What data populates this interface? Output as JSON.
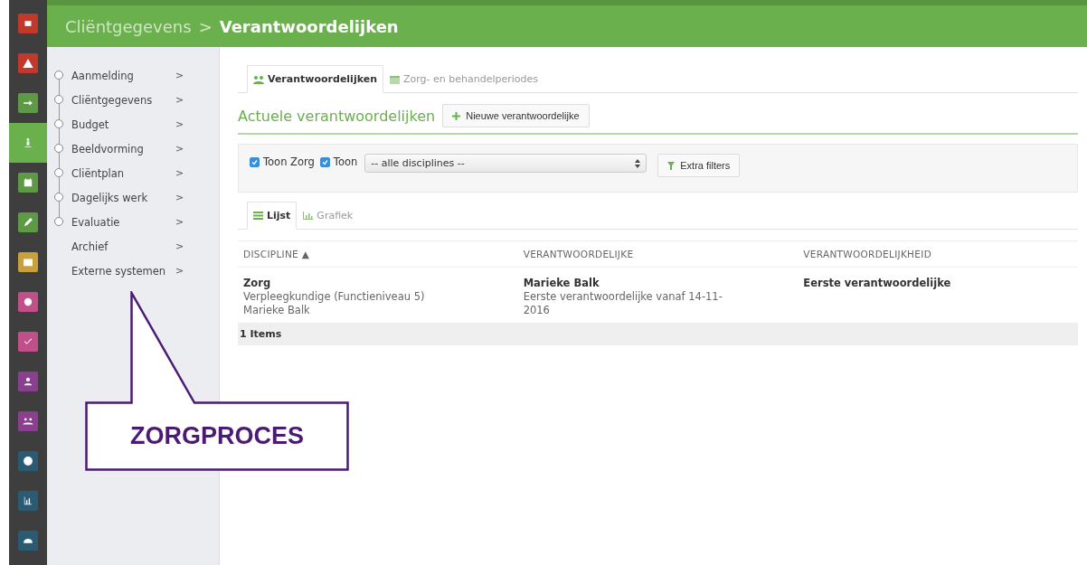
{
  "rail": [
    {
      "color": "#c0392b",
      "selected": false
    },
    {
      "color": "#c0392b",
      "selected": false
    },
    {
      "color": "#5e9a45",
      "selected": false
    },
    {
      "color": "#6ab04c",
      "selected": true
    },
    {
      "color": "#5e9a45",
      "selected": false
    },
    {
      "color": "#5e9a45",
      "selected": false
    },
    {
      "color": "#c9a13a",
      "selected": false
    },
    {
      "color": "#c0508a",
      "selected": false
    },
    {
      "color": "#c0508a",
      "selected": false
    },
    {
      "color": "#8a3f8f",
      "selected": false
    },
    {
      "color": "#8a3f8f",
      "selected": false
    },
    {
      "color": "#2b5a73",
      "selected": false
    },
    {
      "color": "#2b5a73",
      "selected": false
    },
    {
      "color": "#2b5a73",
      "selected": false
    }
  ],
  "header": {
    "parent": "Cliëntgegevens",
    "separator": ">",
    "title": "Verantwoordelijken"
  },
  "sidebar": {
    "items": [
      {
        "label": "Aanmelding",
        "kind": "step",
        "chevron": ">"
      },
      {
        "label": "Cliëntgegevens",
        "kind": "step",
        "chevron": ">"
      },
      {
        "label": "Budget",
        "kind": "step",
        "chevron": ">"
      },
      {
        "label": "Beeldvorming",
        "kind": "step",
        "chevron": ">"
      },
      {
        "label": "Cliëntplan",
        "kind": "step",
        "chevron": ">"
      },
      {
        "label": "Dagelijks werk",
        "kind": "step",
        "chevron": ">"
      },
      {
        "label": "Evaluatie",
        "kind": "step",
        "chevron": ">"
      },
      {
        "label": "Archief",
        "kind": "link",
        "chevron": ">"
      },
      {
        "label": "Externe systemen",
        "kind": "link",
        "chevron": ">"
      }
    ]
  },
  "tabs": [
    {
      "label": "Verantwoordelijken",
      "selected": true
    },
    {
      "label": "Zorg- en behandelperiodes",
      "selected": false
    }
  ],
  "section": {
    "title": "Actuele verantwoordelijken",
    "button": "Nieuwe verantwoordelijke"
  },
  "filters": {
    "checks": [
      {
        "label": "Toon Zorg",
        "checked": true
      },
      {
        "label": "Toon",
        "checked": true
      }
    ],
    "select": "-- alle disciplines --",
    "button": "Extra filters"
  },
  "view_tabs": [
    {
      "label": "Lijst",
      "selected": true
    },
    {
      "label": "Grafiek",
      "selected": false
    }
  ],
  "table": {
    "columns": [
      {
        "label": "DISCIPLINE",
        "sort": "▲"
      },
      {
        "label": "VERANTWOORDELIJKE"
      },
      {
        "label": "VERANTWOORDELIJKHEID"
      }
    ],
    "rows": [
      [
        {
          "main": "Zorg",
          "sub": "Verpleegkundige (Functieniveau 5)\nMarieke Balk"
        },
        {
          "main": "Marieke Balk",
          "sub": "Eerste verantwoordelijke vanaf 14-11-\n2016"
        },
        {
          "main": "Eerste verantwoordelijke"
        }
      ]
    ],
    "footer": "1 Items"
  },
  "callout": {
    "text": "ZORGPROCES"
  }
}
